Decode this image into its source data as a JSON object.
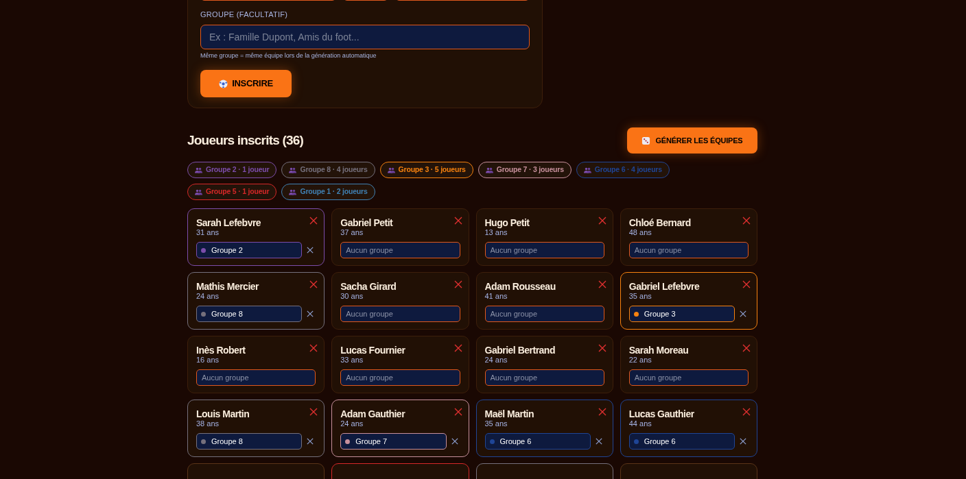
{
  "form": {
    "group_label": "GROUPE (FACULTATIF)",
    "group_placeholder": "Ex : Famille Dupont, Amis du foot...",
    "hint": "Même groupe = même équipe lors de la génération automatique",
    "submit": "INSCRIRE"
  },
  "players_section": {
    "title": "Joueurs inscrits (36)",
    "generate_button": "GÉNÉRER LES ÉQUIPES"
  },
  "group_chips": [
    {
      "label": "Groupe 2 · 1 joueur",
      "color": "#7c4dab"
    },
    {
      "label": "Groupe 8 · 4 joueurs",
      "color": "#75707c"
    },
    {
      "label": "Groupe 3 · 5 joueurs",
      "color": "#f7820f"
    },
    {
      "label": "Groupe 7 · 3 joueurs",
      "color": "#c7909c"
    },
    {
      "label": "Groupe 6 · 4 joueurs",
      "color": "#1f4596"
    },
    {
      "label": "Groupe 5 · 1 joueur",
      "color": "#d62828"
    },
    {
      "label": "Groupe 1 · 2 joueurs",
      "color": "#4081b3"
    }
  ],
  "players": [
    {
      "name": "Sarah Lefebvre",
      "age": "31 ans",
      "group": "Groupe 2",
      "color": "#7c4dab"
    },
    {
      "name": "Gabriel Petit",
      "age": "37 ans",
      "placeholder": "Aucun groupe"
    },
    {
      "name": "Hugo Petit",
      "age": "13 ans",
      "placeholder": "Aucun groupe"
    },
    {
      "name": "Chloé Bernard",
      "age": "48 ans",
      "placeholder": "Aucun groupe"
    },
    {
      "name": "Mathis Mercier",
      "age": "24 ans",
      "group": "Groupe 8",
      "color": "#75707c"
    },
    {
      "name": "Sacha Girard",
      "age": "30 ans",
      "placeholder": "Aucun groupe"
    },
    {
      "name": "Adam Rousseau",
      "age": "41 ans",
      "placeholder": "Aucun groupe"
    },
    {
      "name": "Gabriel Lefebvre",
      "age": "35 ans",
      "group": "Groupe 3",
      "color": "#f7820f"
    },
    {
      "name": "Inès Robert",
      "age": "16 ans",
      "placeholder": "Aucun groupe"
    },
    {
      "name": "Lucas Fournier",
      "age": "33 ans",
      "placeholder": "Aucun groupe"
    },
    {
      "name": "Gabriel Bertrand",
      "age": "24 ans",
      "placeholder": "Aucun groupe"
    },
    {
      "name": "Sarah Moreau",
      "age": "22 ans",
      "placeholder": "Aucun groupe"
    },
    {
      "name": "Louis Martin",
      "age": "38 ans",
      "group": "Groupe 8",
      "color": "#75707c"
    },
    {
      "name": "Adam Gauthier",
      "age": "24 ans",
      "group": "Groupe 7",
      "color": "#c7909c"
    },
    {
      "name": "Maël Martin",
      "age": "35 ans",
      "group": "Groupe 6",
      "color": "#1f4596"
    },
    {
      "name": "Lucas Gauthier",
      "age": "44 ans",
      "group": "Groupe 6",
      "color": "#1f4596"
    }
  ],
  "cut_off_cards": [
    {
      "color": "#5a3418"
    },
    {
      "color": "#d62828"
    },
    {
      "color": "#75707c"
    },
    {
      "color": "#5a3418"
    }
  ]
}
